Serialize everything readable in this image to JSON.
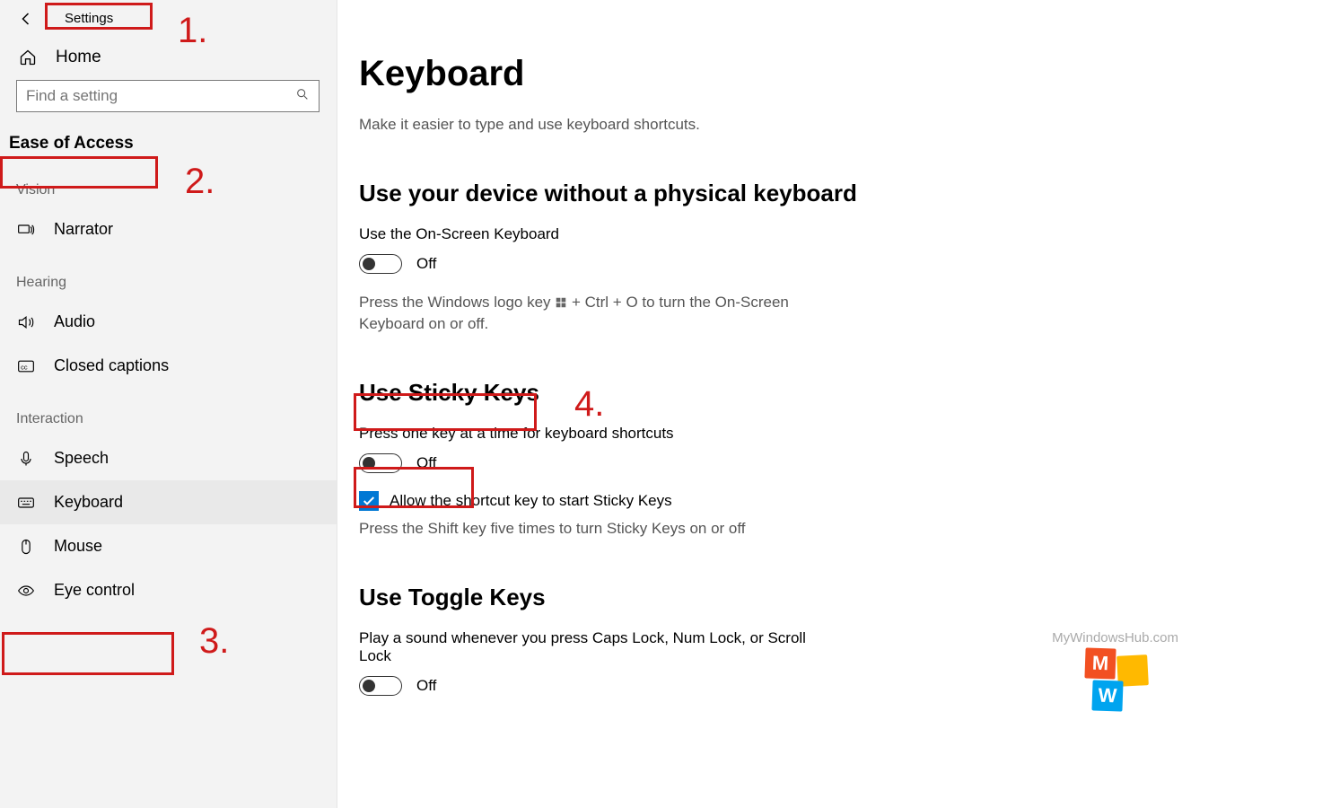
{
  "header": {
    "title": "Settings"
  },
  "sidebar": {
    "home": "Home",
    "search_placeholder": "Find a setting",
    "category": "Ease of Access",
    "sections": {
      "vision": "Vision",
      "hearing": "Hearing",
      "interaction": "Interaction"
    },
    "items": {
      "narrator": "Narrator",
      "audio": "Audio",
      "closed_captions": "Closed captions",
      "speech": "Speech",
      "keyboard": "Keyboard",
      "mouse": "Mouse",
      "eye_control": "Eye control"
    }
  },
  "page": {
    "title": "Keyboard",
    "intro": "Make it easier to type and use keyboard shortcuts.",
    "without_physical": {
      "heading": "Use your device without a physical keyboard",
      "use_osk": "Use the On-Screen Keyboard",
      "osk_state": "Off",
      "osk_hint_before": "Press the Windows logo key ",
      "osk_hint_after": " + Ctrl + O to turn the On-Screen Keyboard on or off."
    },
    "sticky": {
      "heading": "Use Sticky Keys",
      "description": "Press one key at a time for keyboard shortcuts",
      "state": "Off",
      "allow_shortcut": "Allow the shortcut key to start Sticky Keys",
      "allow_hint": "Press the Shift key five times to turn Sticky Keys on or off"
    },
    "togglekeys": {
      "heading": "Use Toggle Keys",
      "description": "Play a sound whenever you press Caps Lock, Num Lock, or Scroll Lock",
      "state": "Off"
    }
  },
  "annotations": {
    "n1": "1.",
    "n2": "2.",
    "n3": "3.",
    "n4": "4."
  },
  "watermark": "MyWindowsHub.com"
}
